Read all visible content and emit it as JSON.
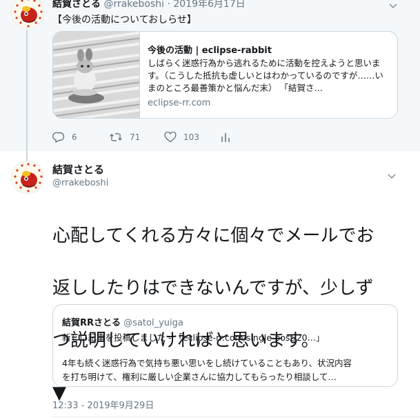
{
  "parent_tweet": {
    "author_name": "結賀さとる",
    "handle": "@rrakeboshi",
    "separator": "·",
    "date": "2019年6月17日",
    "text": "【今後の活動についておしらせ】",
    "card": {
      "title": "今後の活動 | eclipse-rabbit",
      "description": "しばらく迷惑行為から逃れるために活動を控えようと思います。（こうした抵抗も虚しいとはわかっているのですが……いまのところ最善策かと悩んだ末） 「結賀さ…",
      "domain": "eclipse-rr.com"
    },
    "actions": {
      "replies": "6",
      "retweets": "71",
      "likes": "103"
    }
  },
  "main_tweet": {
    "author_name": "結賀さとる",
    "handle": "@rrakeboshi",
    "text_lines": [
      "心配してくれる方々に個々でメールでお",
      "返ししたりはできないんですが、少しず",
      "つ説明していければと思います。",
      "▼"
    ],
    "quote": {
      "author_name": "結賀RRさとる",
      "handle": "@satol_yuiga",
      "line1": "新しい記事を投稿しました - 「eclipse-rr.com/single-post/20…」",
      "line2": "4年も続く迷惑行為で気持ち悪い思いをし続けていることもあり、状況内容",
      "line3": "を打ち明けて、権利に厳しい企業さんに協力してもらったり相談して…"
    },
    "timestamp": "12:33 - 2019年9月29日"
  },
  "colors": {
    "accent": "#1da1f2",
    "muted_text": "#657786",
    "border": "#ccd6dd",
    "parent_bg": "#f5f8fa"
  }
}
